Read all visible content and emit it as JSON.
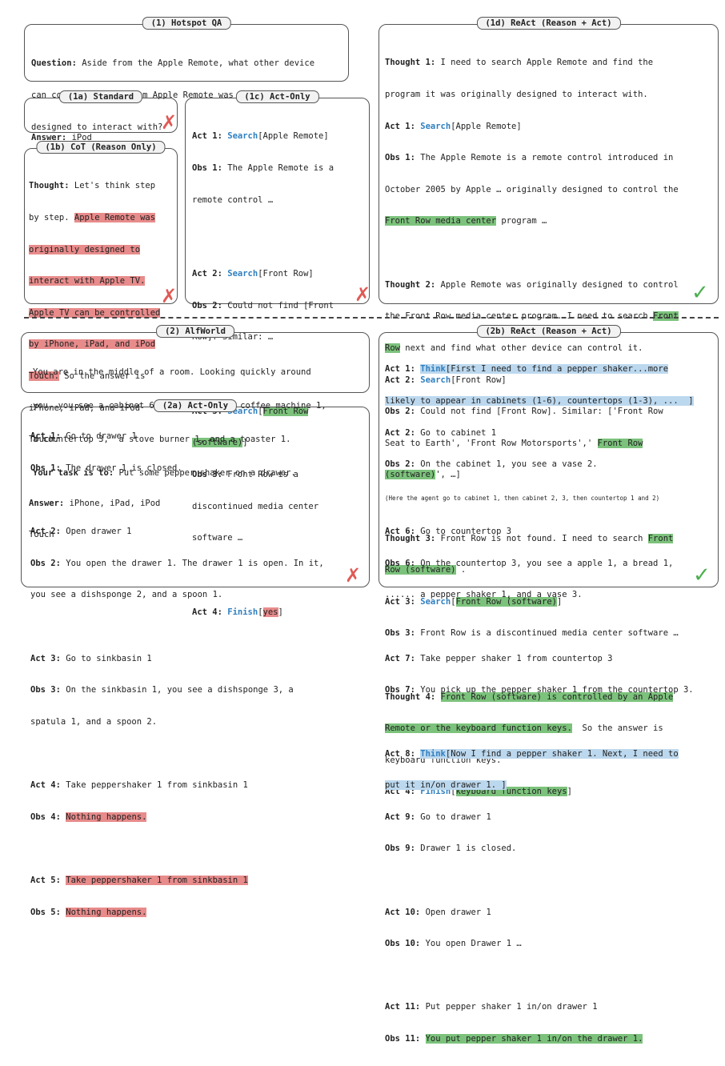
{
  "titles": {
    "hotspot": "(1) Hotspot QA",
    "standard": "(1a) Standard",
    "cot": "(1b) CoT (Reason Only)",
    "actonly": "(1c) Act-Only",
    "react": "(1d) ReAct (Reason + Act)",
    "alfworld": "(2) AlfWorld",
    "alf_actonly": "(2a) Act-Only",
    "alf_react": "(2b) ReAct (Reason + Act)"
  },
  "question": {
    "label": "Question:",
    "lines": [
      " Aside from the Apple Remote, what other device",
      "can control the program Apple Remote was originally",
      "designed to interact with?"
    ]
  },
  "standard": {
    "label": "Answer:",
    "value": " iPod"
  },
  "cot": {
    "thought_label": "Thought:",
    "thought_lines": [
      [
        " Let's think step",
        ""
      ],
      [
        "by step. ",
        "Apple Remote was"
      ],
      [
        "",
        "originally designed to"
      ],
      [
        "",
        "interact with Apple TV."
      ],
      [
        "",
        "Apple TV can be controlled"
      ],
      [
        "",
        "by iPhone, iPad, and iPod"
      ],
      [
        "",
        "Touch."
      ]
    ],
    "tail_lines": [
      " So the answer is",
      "iPhone, iPad, and iPod",
      "Touch."
    ],
    "answer_label": "Answer:",
    "answer_lines": [
      " iPhone, iPad, iPod",
      "Touch"
    ]
  },
  "actonly": {
    "a1": {
      "act": "Act 1:",
      "verb": "Search",
      "arg": "[Apple Remote]",
      "obs": "Obs 1:",
      "obs_lines": [
        " The Apple Remote is a",
        "remote control …"
      ]
    },
    "a2": {
      "act": "Act 2:",
      "verb": "Search",
      "arg": "[Front Row]",
      "obs": "Obs 2:",
      "obs_lines": [
        " Could not find [Front",
        "Row]. Similar: …"
      ]
    },
    "a3": {
      "act": "Act 3:",
      "verb": "Search",
      "arg_hl1": "Front Row",
      "arg_hl2": "(software)",
      "obs": "Obs 3:",
      "obs_lines": [
        " Front Row is a",
        "discontinued media center",
        "software …"
      ]
    },
    "a4": {
      "act": "Act 4:",
      "verb": "Finish",
      "arg_hl": "yes"
    }
  },
  "react": {
    "t1": {
      "label": "Thought 1:",
      "lines": [
        " I need to search Apple Remote and find the",
        "program it was originally designed to interact with."
      ]
    },
    "a1": {
      "label": "Act 1:",
      "verb": "Search",
      "arg": "[Apple Remote]"
    },
    "o1": {
      "label": "Obs 1:",
      "lines": [
        " The Apple Remote is a remote control introduced in",
        "October 2005 by Apple … originally designed to control the"
      ],
      "hl": "Front Row media center",
      "tail": " program …"
    },
    "t2": {
      "label": "Thought 2:",
      "l1": " Apple Remote was originally designed to control",
      "l2a": "the Front Row media center program. I need to search ",
      "l2b": "Front",
      "l3a": "Row",
      "l3b": " next and find what other device can control it."
    },
    "a2": {
      "label": "Act 2:",
      "verb": "Search",
      "arg": "[Front Row]"
    },
    "o2": {
      "label": "Obs 2:",
      "l1": " Could not find [Front Row]. Similar: ['Front Row",
      "l2a": "Seat to Earth', 'Front Row Motorsports',' ",
      "l2b": "Front Row",
      "l3a": "(software)",
      "l3b": "', …]"
    },
    "t3": {
      "label": "Thought 3:",
      "l1a": " Front Row is not found. I need to search ",
      "l1b": "Front",
      "l2a": "Row (software)",
      "l2b": " ."
    },
    "a3": {
      "label": "Act 3:",
      "verb": "Search",
      "arg": "Front Row (software)"
    },
    "o3": {
      "label": "Obs 3:",
      "text": " Front Row is a discontinued media center software …"
    },
    "t4": {
      "label": "Thought 4:",
      "l1": "Front Row (software) is controlled by an Apple",
      "l2a": "Remote or the keyboard function keys.",
      "l2b": "  So the answer is",
      "l3": "keyboard function keys."
    },
    "a4": {
      "label": "Act 4:",
      "verb": "Finish",
      "arg": "keyboard function keys"
    }
  },
  "alfworld": {
    "lines": [
      "You are in the middle of a room. Looking quickly around",
      "you, you see a cabinet 6, a cabinet 1, a coffee machine 1,",
      "a countertop 3,  a stove burner 1, and a toaster 1."
    ],
    "task_label": "Your task is to:",
    "task": " Put some pepper shaker on a drawer."
  },
  "alf_actonly": {
    "rows": [
      {
        "act": "Act 1:",
        "act_text": " Go to drawer 1",
        "obs": "Obs 1:",
        "obs_text": [
          " The drawer 1 is closed."
        ]
      },
      {
        "act": "Act 2:",
        "act_text": " Open drawer 1",
        "obs": "Obs 2:",
        "obs_text": [
          " You open the drawer 1. The drawer 1 is open. In it,",
          "you see a dishsponge 2, and a spoon 1."
        ]
      },
      {
        "act": "Act 3:",
        "act_text": " Go to sinkbasin 1",
        "obs": "Obs 3:",
        "obs_text": [
          " On the sinkbasin 1, you see a dishsponge 3, a",
          "spatula 1, and a spoon 2."
        ]
      },
      {
        "act": "Act 4:",
        "act_text": " Take peppershaker 1 from sinkbasin 1",
        "obs": "Obs 4:",
        "obs_hl": "Nothing happens."
      },
      {
        "act": "Act 5:",
        "act_hl": "Take peppershaker 1 from sinkbasin 1",
        "obs": "Obs 5:",
        "obs_hl": "Nothing happens."
      }
    ]
  },
  "alf_react": {
    "a1": {
      "label": "Act 1:",
      "verb": "Think",
      "l1": "[First I need to find a pepper shaker...more",
      "l2": "likely to appear in cabinets (1-6), countertops (1-3), ...  ]"
    },
    "a2": {
      "label": "Act 2:",
      "text": " Go to cabinet 1"
    },
    "o2": {
      "label": "Obs 2:",
      "text": " On the cabinet 1, you see a vase 2."
    },
    "note": "(Here the agent go to cabinet 1, then cabinet 2, 3, then countertop 1 and 2)",
    "a6": {
      "label": "Act 6:",
      "text": " Go to countertop 3"
    },
    "o6": {
      "label": "Obs 6:",
      "l1": " On the countertop 3, you see a apple 1, a bread 1,",
      "l2": "...... a pepper shaker 1, and a vase 3."
    },
    "a7": {
      "label": "Act 7:",
      "text": " Take pepper shaker 1 from countertop 3"
    },
    "o7": {
      "label": "Obs 7:",
      "text": " You pick up the pepper shaker 1 from the countertop 3."
    },
    "a8": {
      "label": "Act 8:",
      "verb": "Think",
      "l1": "[Now I find a pepper shaker 1. Next, I need to",
      "l2": "put it in/on drawer 1. ]"
    },
    "a9": {
      "label": "Act 9:",
      "text": " Go to drawer 1"
    },
    "o9": {
      "label": "Obs 9:",
      "text": " Drawer 1 is closed."
    },
    "a10": {
      "label": "Act 10:",
      "text": " Open drawer 1"
    },
    "o10": {
      "label": "Obs 10:",
      "text": " You open Drawer 1 …"
    },
    "a11": {
      "label": "Act 11:",
      "text": " Put pepper shaker 1 in/on drawer 1"
    },
    "o11": {
      "label": "Obs 11:",
      "hl": "You put pepper shaker 1 in/on the drawer 1."
    }
  },
  "marks": {
    "cross": "✗",
    "check": "✓"
  },
  "colors": {
    "red_highlight": "#e88b8b",
    "green_highlight": "#7cc27c",
    "blue_highlight": "#bcd8ee",
    "action_blue": "#2f7fc0",
    "cross": "#e05a55",
    "check": "#4caf50"
  }
}
